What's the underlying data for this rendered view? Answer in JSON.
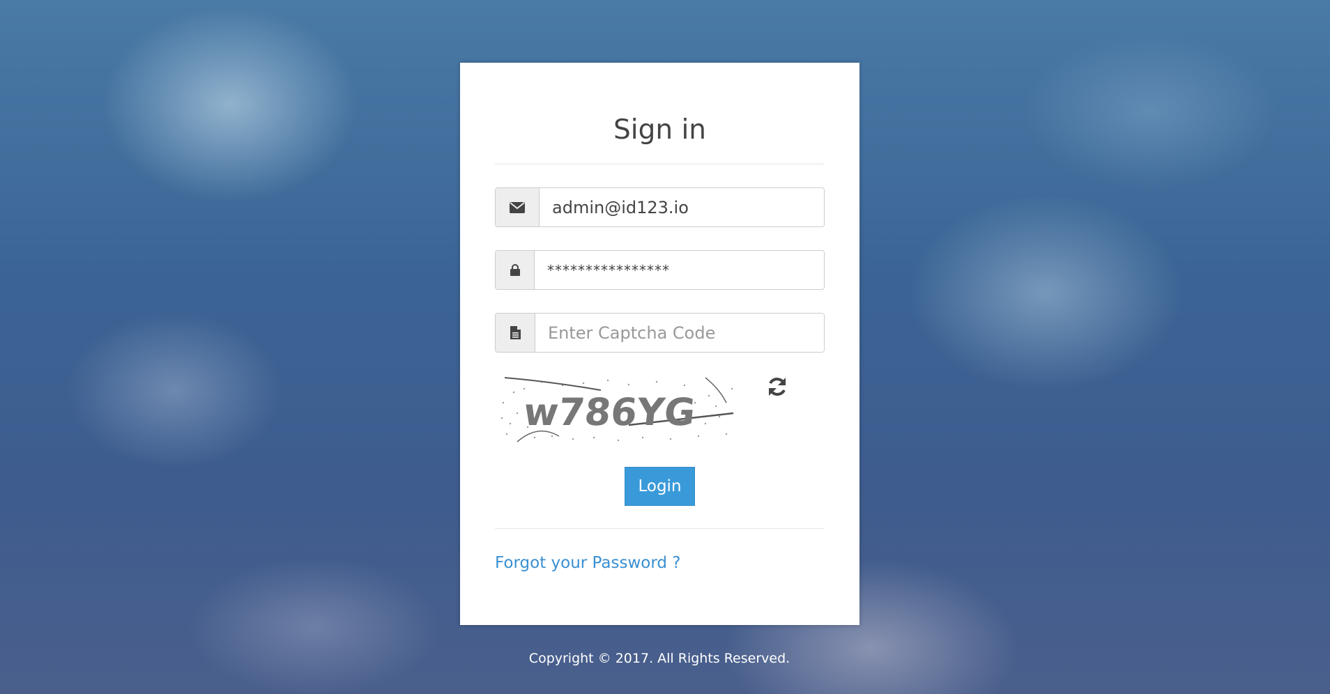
{
  "form": {
    "title": "Sign in",
    "email_value": "admin@id123.io",
    "password_value": "****************",
    "captcha_placeholder": "Enter Captcha Code",
    "captcha_text": "w786YG",
    "login_label": "Login",
    "forgot_label": "Forgot your Password ?"
  },
  "footer": {
    "copyright": "Copyright © 2017. All Rights Reserved."
  },
  "icons": {
    "email": "envelope-icon",
    "password": "lock-icon",
    "captcha": "file-icon",
    "refresh": "refresh-icon"
  },
  "colors": {
    "accent": "#3a9ad9",
    "link": "#3a8fd1",
    "card": "#ffffff"
  }
}
